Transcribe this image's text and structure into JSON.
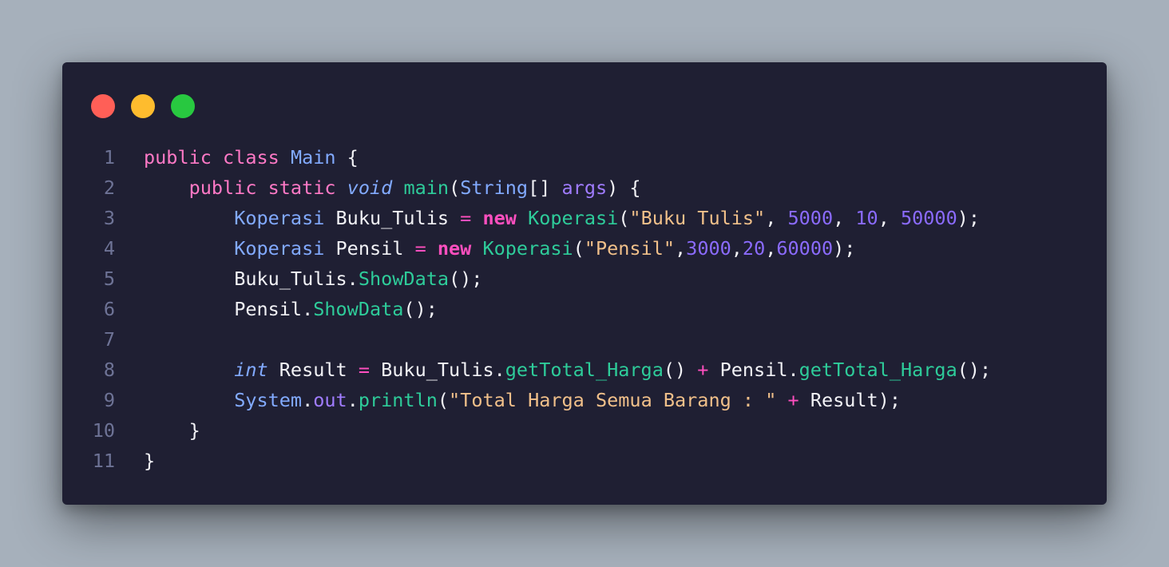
{
  "window": {
    "traffic_lights": [
      {
        "name": "close",
        "color": "#ff5f57"
      },
      {
        "name": "minimize",
        "color": "#febc2e"
      },
      {
        "name": "maximize",
        "color": "#28c840"
      }
    ]
  },
  "code": {
    "language": "java",
    "lines": [
      {
        "number": "1",
        "tokens": [
          {
            "t": "public ",
            "k": "keyword"
          },
          {
            "t": "class ",
            "k": "keyword"
          },
          {
            "t": "Main",
            "k": "class"
          },
          {
            "t": " {",
            "k": "plain"
          }
        ]
      },
      {
        "number": "2",
        "tokens": [
          {
            "t": "    ",
            "k": "plain"
          },
          {
            "t": "public ",
            "k": "keyword"
          },
          {
            "t": "static ",
            "k": "keyword"
          },
          {
            "t": "void",
            "k": "italic-type"
          },
          {
            "t": " ",
            "k": "plain"
          },
          {
            "t": "main",
            "k": "func"
          },
          {
            "t": "(",
            "k": "plain"
          },
          {
            "t": "String",
            "k": "type"
          },
          {
            "t": "[] ",
            "k": "plain"
          },
          {
            "t": "args",
            "k": "param"
          },
          {
            "t": ") {",
            "k": "plain"
          }
        ]
      },
      {
        "number": "3",
        "tokens": [
          {
            "t": "        ",
            "k": "plain"
          },
          {
            "t": "Koperasi",
            "k": "type"
          },
          {
            "t": " Buku_Tulis ",
            "k": "plain"
          },
          {
            "t": "=",
            "k": "op"
          },
          {
            "t": " ",
            "k": "plain"
          },
          {
            "t": "new",
            "k": "keyword-bold"
          },
          {
            "t": " ",
            "k": "plain"
          },
          {
            "t": "Koperasi",
            "k": "func"
          },
          {
            "t": "(",
            "k": "plain"
          },
          {
            "t": "\"Buku Tulis\"",
            "k": "string"
          },
          {
            "t": ", ",
            "k": "plain"
          },
          {
            "t": "5000",
            "k": "number"
          },
          {
            "t": ", ",
            "k": "plain"
          },
          {
            "t": "10",
            "k": "number"
          },
          {
            "t": ", ",
            "k": "plain"
          },
          {
            "t": "50000",
            "k": "number"
          },
          {
            "t": ");",
            "k": "plain"
          }
        ]
      },
      {
        "number": "4",
        "tokens": [
          {
            "t": "        ",
            "k": "plain"
          },
          {
            "t": "Koperasi",
            "k": "type"
          },
          {
            "t": " Pensil ",
            "k": "plain"
          },
          {
            "t": "=",
            "k": "op"
          },
          {
            "t": " ",
            "k": "plain"
          },
          {
            "t": "new",
            "k": "keyword-bold"
          },
          {
            "t": " ",
            "k": "plain"
          },
          {
            "t": "Koperasi",
            "k": "func"
          },
          {
            "t": "(",
            "k": "plain"
          },
          {
            "t": "\"Pensil\"",
            "k": "string"
          },
          {
            "t": ",",
            "k": "plain"
          },
          {
            "t": "3000",
            "k": "number"
          },
          {
            "t": ",",
            "k": "plain"
          },
          {
            "t": "20",
            "k": "number"
          },
          {
            "t": ",",
            "k": "plain"
          },
          {
            "t": "60000",
            "k": "number"
          },
          {
            "t": ");",
            "k": "plain"
          }
        ]
      },
      {
        "number": "5",
        "tokens": [
          {
            "t": "        ",
            "k": "plain"
          },
          {
            "t": "Buku_Tulis.",
            "k": "plain"
          },
          {
            "t": "ShowData",
            "k": "func"
          },
          {
            "t": "();",
            "k": "plain"
          }
        ]
      },
      {
        "number": "6",
        "tokens": [
          {
            "t": "        ",
            "k": "plain"
          },
          {
            "t": "Pensil.",
            "k": "plain"
          },
          {
            "t": "ShowData",
            "k": "func"
          },
          {
            "t": "();",
            "k": "plain"
          }
        ]
      },
      {
        "number": "7",
        "tokens": []
      },
      {
        "number": "8",
        "tokens": [
          {
            "t": "        ",
            "k": "plain"
          },
          {
            "t": "int",
            "k": "italic-type"
          },
          {
            "t": " Result ",
            "k": "plain"
          },
          {
            "t": "=",
            "k": "op"
          },
          {
            "t": " Buku_Tulis.",
            "k": "plain"
          },
          {
            "t": "getTotal_Harga",
            "k": "func"
          },
          {
            "t": "() ",
            "k": "plain"
          },
          {
            "t": "+",
            "k": "op"
          },
          {
            "t": " Pensil.",
            "k": "plain"
          },
          {
            "t": "getTotal_Harga",
            "k": "func"
          },
          {
            "t": "();",
            "k": "plain"
          }
        ]
      },
      {
        "number": "9",
        "tokens": [
          {
            "t": "        ",
            "k": "plain"
          },
          {
            "t": "System",
            "k": "type"
          },
          {
            "t": ".",
            "k": "plain"
          },
          {
            "t": "out",
            "k": "field"
          },
          {
            "t": ".",
            "k": "plain"
          },
          {
            "t": "println",
            "k": "func"
          },
          {
            "t": "(",
            "k": "plain"
          },
          {
            "t": "\"Total Harga Semua Barang : \"",
            "k": "string"
          },
          {
            "t": " ",
            "k": "plain"
          },
          {
            "t": "+",
            "k": "op"
          },
          {
            "t": " Result);",
            "k": "plain"
          }
        ]
      },
      {
        "number": "10",
        "tokens": [
          {
            "t": "    }",
            "k": "plain"
          }
        ]
      },
      {
        "number": "11",
        "tokens": [
          {
            "t": "}",
            "k": "plain"
          }
        ]
      }
    ]
  }
}
